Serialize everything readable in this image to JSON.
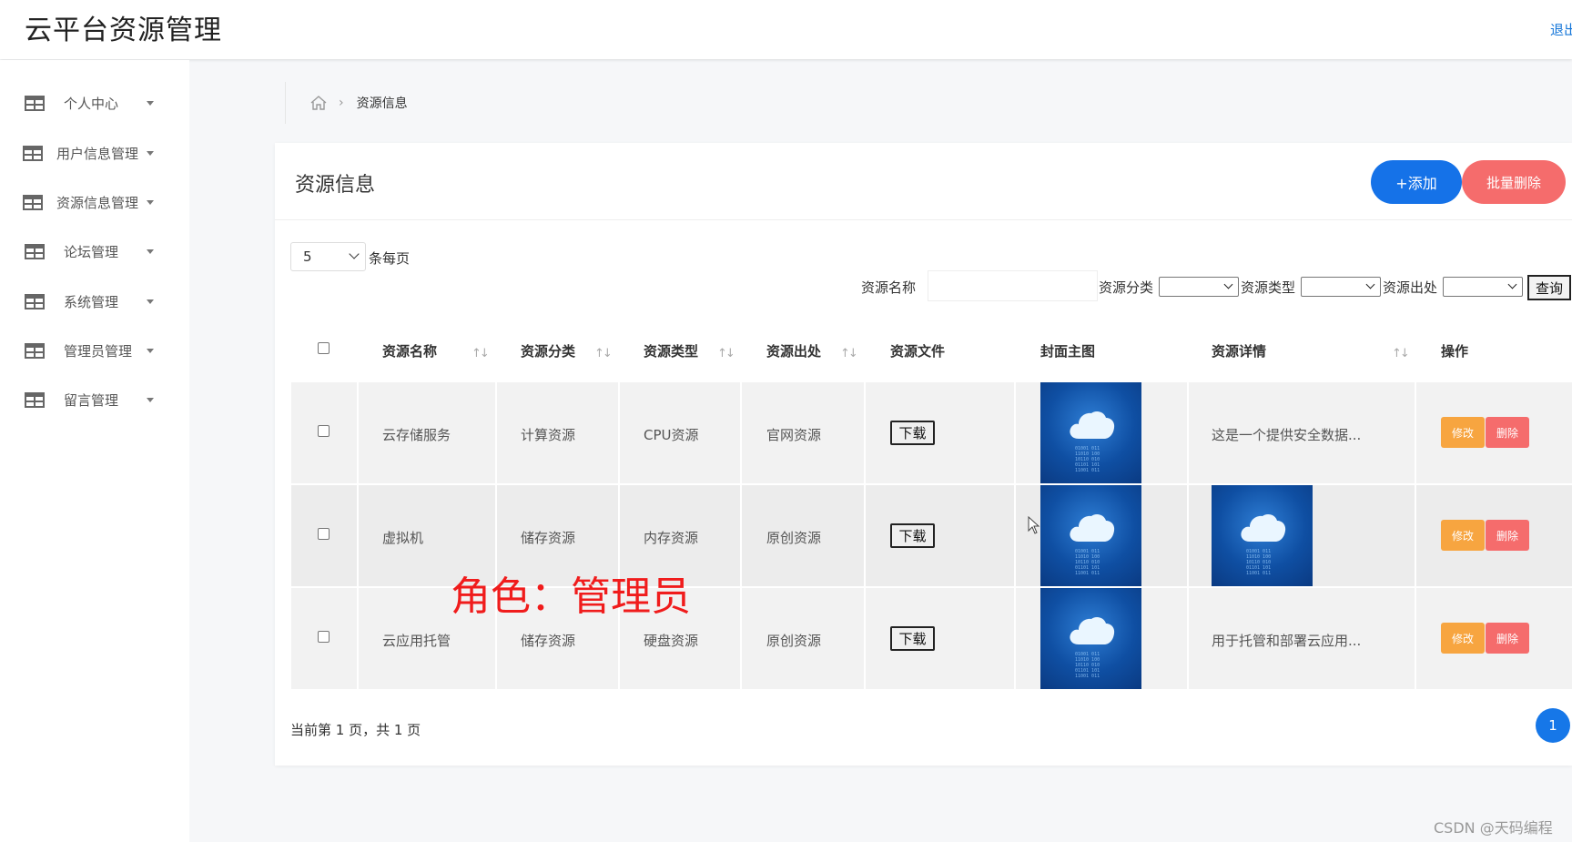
{
  "app": {
    "title": "云平台资源管理",
    "logout_label": "退出"
  },
  "sidebar": {
    "items": [
      {
        "label": "个人中心",
        "icon": "table-icon"
      },
      {
        "label": "用户信息管理",
        "icon": "table-icon"
      },
      {
        "label": "资源信息管理",
        "icon": "table-icon"
      },
      {
        "label": "论坛管理",
        "icon": "table-icon"
      },
      {
        "label": "系统管理",
        "icon": "table-icon"
      },
      {
        "label": "管理员管理",
        "icon": "table-icon"
      },
      {
        "label": "留言管理",
        "icon": "table-icon"
      }
    ]
  },
  "breadcrumb": {
    "home_icon": "home-icon",
    "current": "资源信息"
  },
  "main": {
    "title": "资源信息",
    "add_button": "+添加",
    "batch_delete_button": "批量删除",
    "page_size": {
      "value": "5",
      "label": "条每页"
    },
    "search": {
      "name_label": "资源名称",
      "name_value": "",
      "category_label": "资源分类",
      "type_label": "资源类型",
      "source_label": "资源出处",
      "query_button": "查询"
    },
    "columns": [
      "资源名称",
      "资源分类",
      "资源类型",
      "资源出处",
      "资源文件",
      "封面主图",
      "资源详情",
      "操作"
    ],
    "sort_icon": "↑↓",
    "rows": [
      {
        "name": "云存储服务",
        "category": "计算资源",
        "type": "CPU资源",
        "source": "官网资源",
        "file_button": "下载",
        "detail": "这是一个提供安全数据...",
        "edit": "修改",
        "delete": "删除"
      },
      {
        "name": "虚拟机",
        "category": "储存资源",
        "type": "内存资源",
        "source": "原创资源",
        "file_button": "下载",
        "detail": "",
        "edit": "修改",
        "delete": "删除"
      },
      {
        "name": "云应用托管",
        "category": "储存资源",
        "type": "硬盘资源",
        "source": "原创资源",
        "file_button": "下载",
        "detail": "用于托管和部署云应用...",
        "edit": "修改",
        "delete": "删除"
      }
    ],
    "pager": {
      "text": "当前第 1 页，共 1 页",
      "current_page": "1"
    }
  },
  "overlay": {
    "role_text": "角色：管理员"
  },
  "watermark": "CSDN @天码编程",
  "colors": {
    "primary": "#1572e8",
    "danger": "#f56c6c",
    "warning": "#f7a540",
    "overlay_red": "#f01c1c"
  }
}
